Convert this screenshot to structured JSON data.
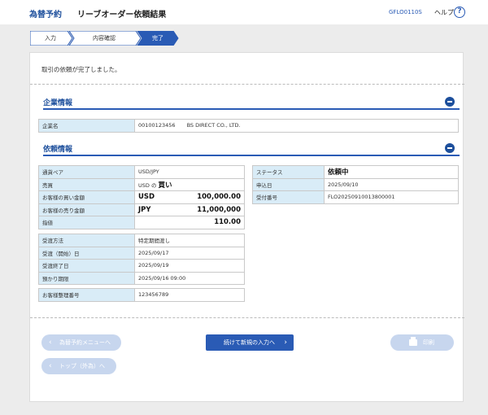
{
  "header": {
    "brand": "為替予約",
    "title": "リーブオーダー依頼結果",
    "screen_id": "GFLO0110S",
    "help_label": "ヘルプ",
    "help_icon_glyph": "?"
  },
  "steps": [
    {
      "label": "入力",
      "state": "done"
    },
    {
      "label": "内容確認",
      "state": "done"
    },
    {
      "label": "完了",
      "state": "current"
    }
  ],
  "message": "取引の依頼が完了しました。",
  "company": {
    "title": "企業情報",
    "label": "企業名",
    "code": "00100123456",
    "name": "BS DIRECT CO., LTD."
  },
  "request": {
    "title": "依頼情報",
    "left1": [
      {
        "label": "通貨ペア",
        "value": "USD/JPY"
      },
      {
        "label": "売買",
        "value_prefix": "USD の",
        "value_strong": "買い"
      },
      {
        "label": "お客様の買い金額",
        "currency": "USD",
        "amount": "100,000.00"
      },
      {
        "label": "お客様の売り金額",
        "currency": "JPY",
        "amount": "11,000,000"
      },
      {
        "label": "指値",
        "amount": "110.00"
      }
    ],
    "left2": [
      {
        "label": "受渡方法",
        "value": "特定期間渡し"
      },
      {
        "label": "受渡（開始）日",
        "value": "2025/09/17"
      },
      {
        "label": "受渡終了日",
        "value": "2025/09/19"
      },
      {
        "label": "預かり期限",
        "value": "2025/09/16 09:00"
      }
    ],
    "left3": [
      {
        "label": "お客様整理番号",
        "value": "123456789"
      }
    ],
    "right": [
      {
        "label": "ステータス",
        "value": "依頼中",
        "strong": true
      },
      {
        "label": "申込日",
        "value": "2025/09/10"
      },
      {
        "label": "受付番号",
        "value": "FLO20250910013800001"
      }
    ]
  },
  "buttons": {
    "menu": "為替予約メニューへ",
    "top": "トップ（外為）へ",
    "continue": "続けて新規の入力へ",
    "print": "印刷"
  },
  "colors": {
    "accent": "#2a5bb5",
    "label_bg": "#d9ecf7",
    "disabled_button": "#c7d6ee"
  }
}
